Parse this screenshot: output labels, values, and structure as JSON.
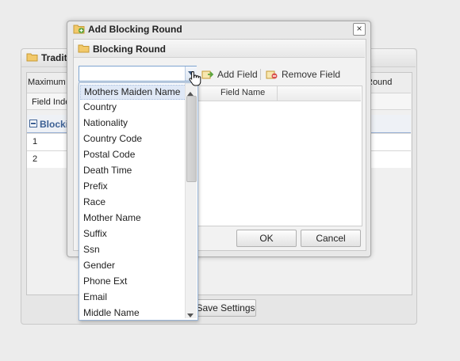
{
  "background": {
    "panel_title": "Traditi",
    "columns": [
      "Maximum B",
      "Round"
    ],
    "subheader": "Field Inde",
    "section_label": "Blockin",
    "rows": [
      "1",
      "2"
    ],
    "save_button": "Save Settings"
  },
  "dialog": {
    "title": "Add Blocking Round",
    "close_label": "×",
    "fieldset_title": "Blocking Round",
    "toolbar": {
      "add_field": "Add Field",
      "remove_field": "Remove Field"
    },
    "grid_header": "Field Name",
    "ok_button": "OK",
    "cancel_button": "Cancel"
  },
  "combo": {
    "value": ""
  },
  "dropdown": {
    "items": [
      "Mothers Maiden Name",
      "Country",
      "Nationality",
      "Country Code",
      "Postal Code",
      "Death Time",
      "Prefix",
      "Race",
      "Mother Name",
      "Suffix",
      "Ssn",
      "Gender",
      "Phone Ext",
      "Email",
      "Middle Name"
    ],
    "selected_index": 0
  },
  "colors": {
    "accent_blue": "#3b5f93",
    "folder_yellow": "#f2c96a",
    "add_green": "#5aa43d",
    "remove_red": "#d9534f"
  },
  "icons": [
    "folder-icon",
    "add-window-icon",
    "add-field-icon",
    "remove-field-icon",
    "close-icon",
    "chevron-down-icon",
    "hand-cursor-icon"
  ]
}
